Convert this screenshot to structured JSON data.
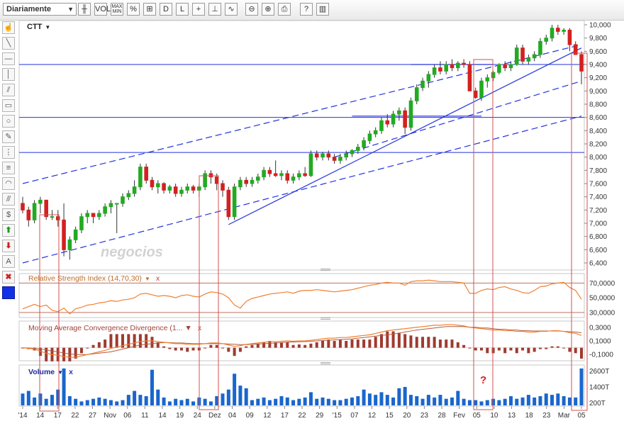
{
  "toolbar": {
    "period_select": "Diariamente",
    "buttons": [
      {
        "name": "candlestick-icon",
        "glyph": "╫"
      },
      {
        "name": "volume-toggle",
        "glyph": "VOL"
      },
      {
        "name": "maxmin-toggle",
        "glyph": "MAX MIN"
      },
      {
        "name": "percent-icon",
        "glyph": "%"
      },
      {
        "name": "compare-icon",
        "glyph": "⊞"
      },
      {
        "name": "draw-icon",
        "glyph": "D"
      },
      {
        "name": "line-icon",
        "glyph": "L"
      },
      {
        "name": "crosshair-icon",
        "glyph": "+"
      },
      {
        "name": "timeline-icon",
        "glyph": "⊥"
      },
      {
        "name": "indicator-icon",
        "glyph": "∿"
      },
      {
        "name": "zoom-out-icon",
        "glyph": "⊖"
      },
      {
        "name": "zoom-in-icon",
        "glyph": "⊕"
      },
      {
        "name": "print-icon",
        "glyph": "⎙"
      },
      {
        "name": "help-icon",
        "glyph": "?"
      },
      {
        "name": "book-icon",
        "glyph": "▥"
      }
    ]
  },
  "sidebar": [
    {
      "name": "pan-tool-icon",
      "glyph": "☝"
    },
    {
      "name": "trendline-tool-icon",
      "glyph": "╲"
    },
    {
      "name": "horizontal-line-tool-icon",
      "glyph": "—"
    },
    {
      "name": "vertical-line-tool-icon",
      "glyph": "│"
    },
    {
      "name": "channel-tool-icon",
      "glyph": "⫽"
    },
    {
      "name": "rectangle-tool-icon",
      "glyph": "▭"
    },
    {
      "name": "ellipse-tool-icon",
      "glyph": "○"
    },
    {
      "name": "pencil-tool-icon",
      "glyph": "✎"
    },
    {
      "name": "fibonacci-tool-icon",
      "glyph": "⋮"
    },
    {
      "name": "gann-tool-icon",
      "glyph": "≡"
    },
    {
      "name": "arc-tool-icon",
      "glyph": "◠"
    },
    {
      "name": "fan-tool-icon",
      "glyph": "⫻"
    },
    {
      "name": "dollar-tool-icon",
      "glyph": "$"
    },
    {
      "name": "buy-arrow-icon",
      "glyph": "⬆"
    },
    {
      "name": "sell-arrow-icon",
      "glyph": "⬇"
    },
    {
      "name": "text-tool-icon",
      "glyph": "A"
    },
    {
      "name": "delete-icon",
      "glyph": "✖"
    },
    {
      "name": "color-picker-icon",
      "glyph": ""
    }
  ],
  "colors": {
    "up": "#22aa22",
    "down": "#d42020",
    "line": "#2233dd",
    "rsi": "#f08030",
    "volume": "#1a66cc",
    "box": "#d65050"
  },
  "watermark": "negocios",
  "annotation": "?",
  "chart_data": [
    {
      "type": "candlestick",
      "title": "CTT",
      "y_ticks": [
        "10,000",
        "9,800",
        "9,600",
        "9,400",
        "9,200",
        "9,000",
        "8,800",
        "8,600",
        "8,400",
        "8,200",
        "8,000",
        "7,800",
        "7,600",
        "7,400",
        "7,200",
        "7,000",
        "6,800",
        "6,600",
        "6,400"
      ],
      "ylim": [
        6.4,
        10.0
      ],
      "x_tick_labels": [
        "'14",
        "14",
        "17",
        "22",
        "27",
        "Nov",
        "06",
        "11",
        "14",
        "19",
        "24",
        "Dez",
        "04",
        "09",
        "12",
        "17",
        "22",
        "29",
        "'15",
        "07",
        "12",
        "15",
        "20",
        "23",
        "28",
        "Fev",
        "05",
        "10",
        "13",
        "18",
        "23",
        "Mar",
        "05"
      ],
      "candles": [
        [
          7.3,
          7.4,
          7.15,
          7.2
        ],
        [
          7.2,
          7.25,
          6.95,
          7.05
        ],
        [
          7.05,
          7.35,
          7.0,
          7.3
        ],
        [
          7.3,
          7.4,
          7.15,
          7.35
        ],
        [
          7.35,
          7.35,
          7.05,
          7.1
        ],
        [
          7.1,
          7.2,
          7.05,
          7.1
        ],
        [
          7.1,
          7.2,
          6.95,
          7.05
        ],
        [
          7.05,
          7.3,
          6.5,
          6.6
        ],
        [
          6.6,
          6.8,
          6.45,
          6.75
        ],
        [
          6.75,
          6.95,
          6.7,
          6.9
        ],
        [
          6.9,
          7.15,
          6.85,
          7.1
        ],
        [
          7.1,
          7.2,
          7.0,
          7.15
        ],
        [
          7.15,
          7.15,
          7.0,
          7.1
        ],
        [
          7.1,
          7.2,
          7.05,
          7.15
        ],
        [
          7.15,
          7.3,
          7.1,
          7.25
        ],
        [
          7.25,
          7.35,
          7.15,
          7.3
        ],
        [
          7.3,
          7.3,
          6.85,
          7.3
        ],
        [
          7.3,
          7.45,
          7.25,
          7.4
        ],
        [
          7.4,
          7.5,
          7.35,
          7.45
        ],
        [
          7.45,
          7.65,
          7.4,
          7.55
        ],
        [
          7.55,
          7.9,
          7.5,
          7.85
        ],
        [
          7.85,
          7.9,
          7.6,
          7.65
        ],
        [
          7.65,
          7.7,
          7.5,
          7.55
        ],
        [
          7.55,
          7.65,
          7.45,
          7.6
        ],
        [
          7.6,
          7.62,
          7.45,
          7.5
        ],
        [
          7.5,
          7.58,
          7.45,
          7.55
        ],
        [
          7.55,
          7.6,
          7.4,
          7.45
        ],
        [
          7.45,
          7.55,
          7.4,
          7.5
        ],
        [
          7.5,
          7.6,
          7.45,
          7.55
        ],
        [
          7.55,
          7.58,
          7.45,
          7.5
        ],
        [
          7.5,
          7.6,
          7.4,
          7.55
        ],
        [
          7.55,
          7.8,
          7.5,
          7.75
        ],
        [
          7.75,
          7.8,
          7.6,
          7.7
        ],
        [
          7.7,
          7.75,
          7.5,
          7.6
        ],
        [
          7.6,
          7.65,
          7.4,
          7.5
        ],
        [
          7.5,
          7.55,
          7.05,
          7.1
        ],
        [
          7.1,
          7.6,
          7.05,
          7.55
        ],
        [
          7.55,
          7.7,
          7.5,
          7.65
        ],
        [
          7.65,
          7.7,
          7.55,
          7.6
        ],
        [
          7.6,
          7.7,
          7.55,
          7.65
        ],
        [
          7.65,
          7.75,
          7.6,
          7.7
        ],
        [
          7.7,
          7.85,
          7.65,
          7.8
        ],
        [
          7.8,
          7.85,
          7.7,
          7.75
        ],
        [
          7.75,
          7.95,
          7.7,
          7.72
        ],
        [
          7.72,
          7.8,
          7.65,
          7.75
        ],
        [
          7.75,
          7.8,
          7.6,
          7.65
        ],
        [
          7.65,
          7.75,
          7.6,
          7.7
        ],
        [
          7.7,
          7.8,
          7.65,
          7.75
        ],
        [
          7.75,
          7.85,
          7.7,
          7.72
        ],
        [
          7.72,
          8.1,
          7.7,
          8.05
        ],
        [
          8.05,
          8.1,
          7.95,
          8.0
        ],
        [
          8.0,
          8.08,
          7.95,
          8.05
        ],
        [
          8.05,
          8.1,
          7.95,
          8.0
        ],
        [
          8.0,
          8.05,
          7.9,
          7.95
        ],
        [
          7.95,
          8.05,
          7.9,
          8.0
        ],
        [
          8.0,
          8.1,
          7.95,
          8.05
        ],
        [
          8.05,
          8.12,
          8.0,
          8.1
        ],
        [
          8.1,
          8.2,
          8.05,
          8.15
        ],
        [
          8.15,
          8.3,
          8.1,
          8.25
        ],
        [
          8.25,
          8.4,
          8.2,
          8.35
        ],
        [
          8.35,
          8.45,
          8.3,
          8.4
        ],
        [
          8.4,
          8.6,
          8.35,
          8.55
        ],
        [
          8.55,
          8.65,
          8.45,
          8.5
        ],
        [
          8.5,
          8.7,
          8.45,
          8.65
        ],
        [
          8.65,
          8.75,
          8.55,
          8.7
        ],
        [
          8.7,
          8.75,
          8.35,
          8.45
        ],
        [
          8.45,
          8.9,
          8.4,
          8.85
        ],
        [
          8.85,
          9.1,
          8.8,
          9.05
        ],
        [
          9.05,
          9.2,
          9.0,
          9.15
        ],
        [
          9.15,
          9.3,
          9.05,
          9.25
        ],
        [
          9.25,
          9.4,
          9.2,
          9.35
        ],
        [
          9.35,
          9.45,
          9.25,
          9.3
        ],
        [
          9.3,
          9.45,
          9.25,
          9.4
        ],
        [
          9.4,
          9.48,
          9.3,
          9.35
        ],
        [
          9.35,
          9.45,
          9.3,
          9.42
        ],
        [
          9.42,
          9.48,
          9.35,
          9.4
        ],
        [
          9.4,
          9.45,
          9.0,
          9.0
        ],
        [
          9.0,
          9.05,
          8.88,
          8.9
        ],
        [
          8.9,
          9.2,
          8.85,
          9.15
        ],
        [
          9.15,
          9.25,
          9.05,
          9.2
        ],
        [
          9.2,
          9.3,
          9.15,
          9.28
        ],
        [
          9.28,
          9.42,
          9.25,
          9.4
        ],
        [
          9.4,
          9.45,
          9.3,
          9.35
        ],
        [
          9.35,
          9.45,
          9.3,
          9.4
        ],
        [
          9.4,
          9.7,
          9.38,
          9.65
        ],
        [
          9.65,
          9.7,
          9.4,
          9.45
        ],
        [
          9.45,
          9.55,
          9.4,
          9.5
        ],
        [
          9.5,
          9.6,
          9.45,
          9.55
        ],
        [
          9.55,
          9.8,
          9.5,
          9.75
        ],
        [
          9.75,
          9.85,
          9.7,
          9.8
        ],
        [
          9.8,
          10.0,
          9.75,
          9.95
        ],
        [
          9.95,
          10.0,
          9.85,
          9.9
        ],
        [
          9.9,
          9.95,
          9.85,
          9.92
        ],
        [
          9.92,
          9.95,
          9.6,
          9.7
        ],
        [
          9.7,
          9.75,
          9.55,
          9.55
        ],
        [
          9.55,
          9.6,
          9.1,
          9.3
        ]
      ],
      "horizontal_lines": [
        9.4,
        8.6,
        8.07
      ],
      "trendlines": [
        {
          "style": "solid",
          "from": [
            35,
            6.98
          ],
          "to": [
            95,
            9.65
          ]
        },
        {
          "style": "dashed",
          "from": [
            0,
            7.6
          ],
          "to": [
            95,
            9.7
          ]
        },
        {
          "style": "dashed",
          "from": [
            0,
            6.4
          ],
          "to": [
            95,
            8.62
          ]
        },
        {
          "style": "dashed",
          "from": [
            53,
            8.0
          ],
          "to": [
            95,
            9.15
          ]
        }
      ],
      "segments": [
        {
          "from": [
            66,
            9.4
          ],
          "to": [
            80,
            9.4
          ]
        },
        {
          "from": [
            56,
            8.62
          ],
          "to": [
            78,
            8.62
          ]
        }
      ]
    },
    {
      "type": "line",
      "title": "Relative Strength Index (14,70,30)",
      "close_icon": "x",
      "menu_icon": "▼",
      "y_ticks": [
        "70,0000",
        "50,0000",
        "30,0000"
      ],
      "ylim": [
        25,
        80
      ],
      "bands": [
        70,
        30
      ],
      "values": [
        35,
        38,
        41,
        38,
        40,
        33,
        31,
        36,
        28,
        35,
        37,
        40,
        41,
        43,
        44,
        46,
        45,
        47,
        48,
        50,
        55,
        56,
        54,
        52,
        53,
        52,
        50,
        53,
        54,
        52,
        51,
        55,
        58,
        57,
        55,
        50,
        40,
        36,
        45,
        49,
        51,
        53,
        55,
        56,
        57,
        58,
        56,
        59,
        60,
        60,
        61,
        60,
        59,
        58,
        59,
        60,
        61,
        63,
        65,
        67,
        68,
        70,
        71,
        70,
        70,
        67,
        72,
        73,
        73,
        74,
        73,
        72,
        72,
        72,
        71,
        70,
        56,
        56,
        60,
        62,
        61,
        64,
        65,
        62,
        60,
        57,
        56,
        60,
        65,
        66,
        69,
        70,
        71,
        64,
        60,
        48
      ]
    },
    {
      "type": "line",
      "title": "Moving Average Convergence Divergence (1... ▼",
      "close_icon": "x",
      "y_ticks": [
        "0,3000",
        "0,1000",
        "-0,1000"
      ],
      "ylim": [
        -0.16,
        0.36
      ],
      "series": [
        {
          "name": "",
          "values": [
            0.0,
            -0.01,
            -0.02,
            -0.05,
            -0.08,
            -0.1,
            -0.11,
            -0.13,
            -0.14,
            -0.14,
            -0.12,
            -0.1,
            -0.08,
            -0.06,
            -0.04,
            -0.01,
            0.01,
            0.03,
            0.05,
            0.07,
            0.09,
            0.1,
            0.1,
            0.09,
            0.08,
            0.07,
            0.06,
            0.06,
            0.05,
            0.05,
            0.05,
            0.06,
            0.07,
            0.07,
            0.06,
            0.04,
            0.02,
            0.03,
            0.05,
            0.06,
            0.07,
            0.08,
            0.09,
            0.09,
            0.095,
            0.1,
            0.095,
            0.1,
            0.1,
            0.11,
            0.12,
            0.13,
            0.14,
            0.14,
            0.15,
            0.15,
            0.16,
            0.17,
            0.18,
            0.19,
            0.21,
            0.23,
            0.25,
            0.26,
            0.27,
            0.28,
            0.29,
            0.3,
            0.31,
            0.32,
            0.33,
            0.33,
            0.34,
            0.34,
            0.33,
            0.32,
            0.3,
            0.29,
            0.28,
            0.27,
            0.26,
            0.26,
            0.25,
            0.25,
            0.24,
            0.24,
            0.23,
            0.23,
            0.24,
            0.24,
            0.25,
            0.25,
            0.24,
            0.22,
            0.21,
            0.18
          ]
        },
        {
          "name": "",
          "values": [
            0.0,
            -0.005,
            -0.01,
            -0.02,
            -0.03,
            -0.05,
            -0.06,
            -0.08,
            -0.09,
            -0.1,
            -0.1,
            -0.1,
            -0.09,
            -0.08,
            -0.07,
            -0.06,
            -0.04,
            -0.02,
            0.0,
            0.02,
            0.04,
            0.05,
            0.06,
            0.07,
            0.075,
            0.075,
            0.07,
            0.07,
            0.065,
            0.06,
            0.06,
            0.06,
            0.06,
            0.06,
            0.06,
            0.055,
            0.05,
            0.045,
            0.045,
            0.05,
            0.055,
            0.06,
            0.065,
            0.07,
            0.075,
            0.08,
            0.085,
            0.088,
            0.09,
            0.095,
            0.1,
            0.105,
            0.11,
            0.115,
            0.12,
            0.125,
            0.13,
            0.14,
            0.15,
            0.16,
            0.17,
            0.18,
            0.19,
            0.2,
            0.215,
            0.23,
            0.245,
            0.26,
            0.27,
            0.28,
            0.29,
            0.3,
            0.31,
            0.31,
            0.31,
            0.31,
            0.3,
            0.3,
            0.29,
            0.29,
            0.28,
            0.27,
            0.27,
            0.26,
            0.26,
            0.25,
            0.25,
            0.245,
            0.245,
            0.245,
            0.245,
            0.245,
            0.24,
            0.235,
            0.23,
            0.22
          ]
        }
      ]
    },
    {
      "type": "bar",
      "title": "Volume",
      "close_icon": "x",
      "menu_icon": "▼",
      "y_ticks": [
        "2600T",
        "1400T",
        "200T"
      ],
      "ylim": [
        0,
        2900
      ],
      "values": [
        900,
        1100,
        600,
        900,
        500,
        800,
        1200,
        2800,
        700,
        500,
        300,
        400,
        500,
        600,
        500,
        400,
        300,
        400,
        800,
        1100,
        800,
        700,
        2700,
        1200,
        600,
        300,
        500,
        400,
        500,
        300,
        600,
        500,
        300,
        700,
        900,
        1200,
        2400,
        1500,
        1300,
        400,
        500,
        600,
        400,
        500,
        700,
        600,
        400,
        500,
        600,
        1000,
        500,
        600,
        500,
        400,
        400,
        500,
        600,
        700,
        1200,
        900,
        800,
        1000,
        800,
        600,
        1300,
        1400,
        800,
        700,
        500,
        800,
        600,
        800,
        500,
        600,
        1100,
        500,
        400,
        400,
        300,
        400,
        500,
        400,
        500,
        700,
        500,
        600,
        800,
        600,
        700,
        900,
        800,
        900,
        700,
        600,
        600,
        2800
      ]
    }
  ]
}
